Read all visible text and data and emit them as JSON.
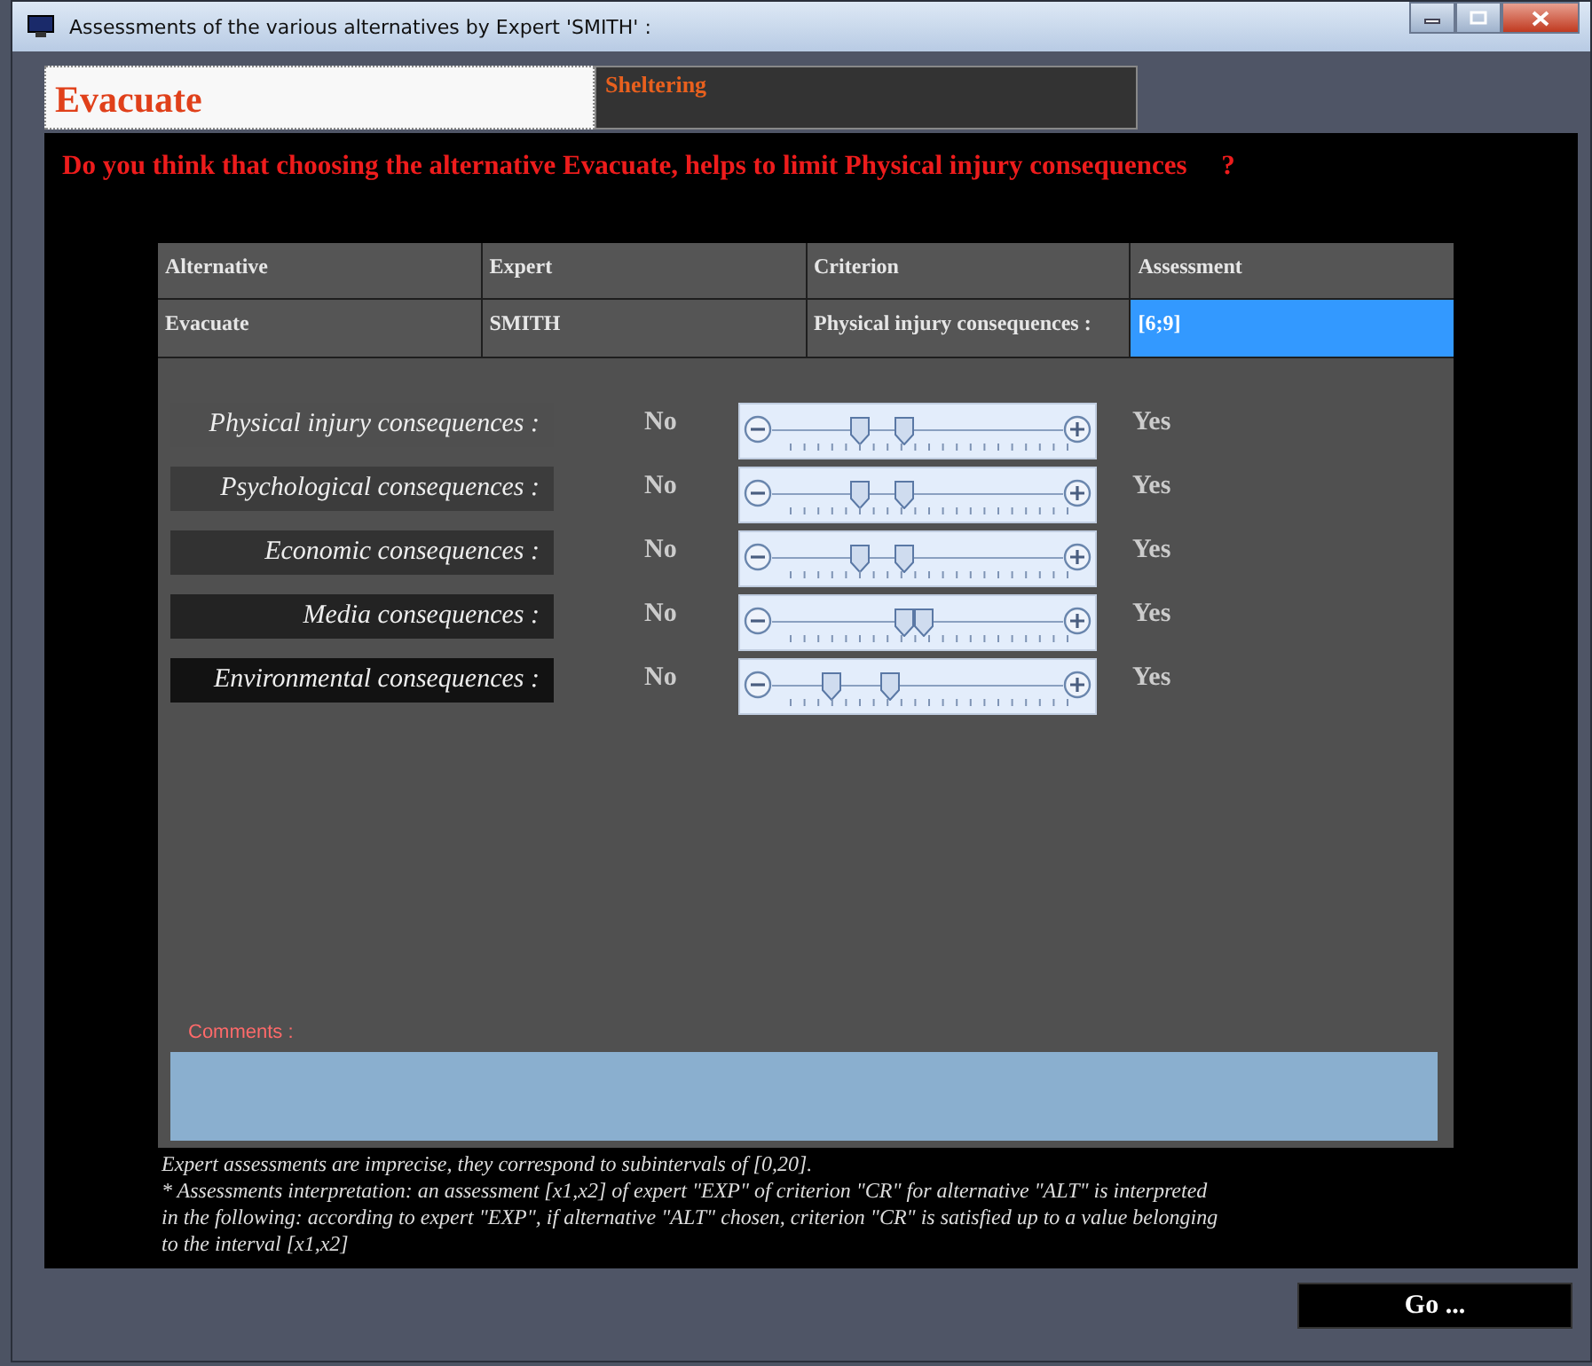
{
  "window": {
    "title": "Assessments of the various alternatives by Expert 'SMITH' :"
  },
  "tabs": [
    {
      "label": "Evacuate",
      "selected": true
    },
    {
      "label": "Sheltering",
      "selected": false
    }
  ],
  "question": "Do you think that choosing the alternative Evacuate, helps to limit Physical injury consequences     ?",
  "table": {
    "columns": [
      "Alternative",
      "Expert",
      "Criterion",
      "Assessment"
    ],
    "rows": [
      {
        "cells": [
          {
            "text": "Evacuate",
            "selected": false
          },
          {
            "text": "SMITH",
            "selected": false
          },
          {
            "text": "Physical injury consequences :",
            "selected": false
          },
          {
            "text": "[6;9]",
            "selected": true
          }
        ]
      }
    ]
  },
  "criteria": [
    {
      "label": "Physical injury consequences :",
      "color": "#4f4f4f",
      "low_label": "No",
      "high_label": "Yes",
      "thumbs": [
        {
          "level": 0.3
        },
        {
          "level": 0.45
        }
      ]
    },
    {
      "label": "Psychological consequences :",
      "color": "#3c3c3c",
      "low_label": "No",
      "high_label": "Yes",
      "thumbs": [
        {
          "level": 0.3
        },
        {
          "level": 0.45
        }
      ]
    },
    {
      "label": "Economic consequences :",
      "color": "#323232",
      "low_label": "No",
      "high_label": "Yes",
      "thumbs": [
        {
          "level": 0.3
        },
        {
          "level": 0.45
        }
      ]
    },
    {
      "label": "Media consequences :",
      "color": "#232323",
      "low_label": "No",
      "high_label": "Yes",
      "thumbs": [
        {
          "level": 0.45
        },
        {
          "level": 0.52
        }
      ]
    },
    {
      "label": "Environmental consequences :",
      "color": "#121212",
      "low_label": "No",
      "high_label": "Yes",
      "thumbs": [
        {
          "level": 0.2
        },
        {
          "level": 0.4
        }
      ]
    }
  ],
  "comments": {
    "label": "Comments :"
  },
  "notes": [
    "Expert assessments are imprecise, they correspond to subintervals of [0,20].",
    "* Assessments interpretation: an assessment [x1,x2] of expert \"EXP\" of criterion \"CR\" for alternative \"ALT\" is interpreted in the following: according to expert \"EXP\", if alternative \"ALT\" chosen, criterion \"CR\" is satisfied up to a value belonging to the interval [x1,x2]"
  ],
  "buttons": [
    "Go ..."
  ]
}
